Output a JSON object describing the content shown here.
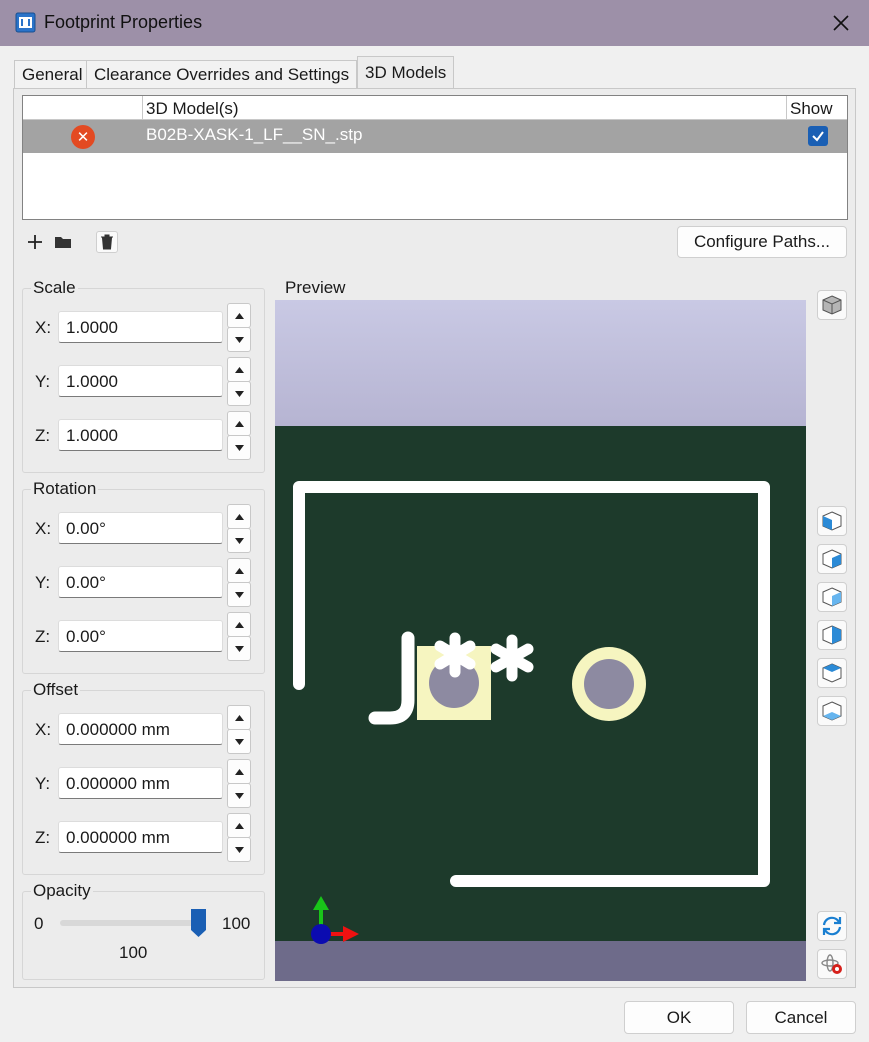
{
  "window": {
    "title": "Footprint Properties"
  },
  "tabs": [
    {
      "label": "General"
    },
    {
      "label": "Clearance Overrides and Settings"
    },
    {
      "label": "3D Models"
    }
  ],
  "models_table": {
    "headers": [
      "",
      "3D Model(s)",
      "Show"
    ],
    "rows": [
      {
        "status": "error",
        "filename": "B02B-XASK-1_LF__SN_.stp",
        "show": true
      }
    ]
  },
  "toolbar": {
    "configure_paths_label": "Configure Paths..."
  },
  "scale": {
    "label": "Scale",
    "x_label": "X:",
    "y_label": "Y:",
    "z_label": "Z:",
    "x": "1.0000",
    "y": "1.0000",
    "z": "1.0000"
  },
  "rotation": {
    "label": "Rotation",
    "x_label": "X:",
    "y_label": "Y:",
    "z_label": "Z:",
    "x": "0.00°",
    "y": "0.00°",
    "z": "0.00°"
  },
  "offset": {
    "label": "Offset",
    "x_label": "X:",
    "y_label": "Y:",
    "z_label": "Z:",
    "x": "0.000000 mm",
    "y": "0.000000 mm",
    "z": "0.000000 mm"
  },
  "opacity": {
    "label": "Opacity",
    "min": "0",
    "max": "100",
    "value": "100",
    "level": 1.0
  },
  "preview": {
    "label": "Preview",
    "reference_text": "J**"
  },
  "footer": {
    "ok_label": "OK",
    "cancel_label": "Cancel"
  },
  "colors": {
    "titlebar": "#9d90a8",
    "board": "#1d3a2b",
    "sky": "#cfcfe6",
    "pad": "#f6f5c0",
    "accent": "#1a5fb4"
  }
}
